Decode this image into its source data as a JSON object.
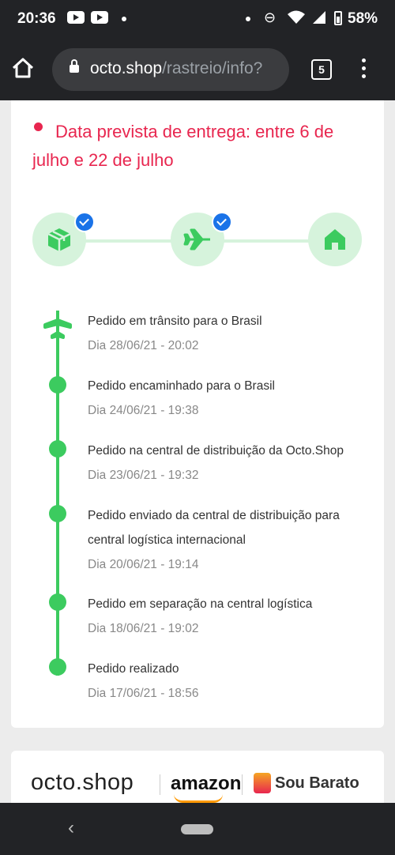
{
  "status_bar": {
    "time": "20:36",
    "battery": "58%"
  },
  "browser": {
    "url_domain": "octo.shop",
    "url_path": "/rastreio/info?",
    "tab_count": "5"
  },
  "delivery": {
    "estimate_text": "Data prevista de entrega: entre 6 de julho e 22 de julho"
  },
  "stepper": {
    "steps": [
      {
        "icon": "package-icon",
        "completed": true
      },
      {
        "icon": "airplane-icon",
        "completed": true
      },
      {
        "icon": "home-icon",
        "completed": false
      }
    ]
  },
  "timeline": {
    "events": [
      {
        "title": "Pedido em trânsito para o Brasil",
        "date": "Dia 28/06/21 - 20:02"
      },
      {
        "title": "Pedido encaminhado para o Brasil",
        "date": "Dia 24/06/21 - 19:38"
      },
      {
        "title": "Pedido na central de distribuição da Octo.Shop",
        "date": "Dia 23/06/21 - 19:32"
      },
      {
        "title": "Pedido enviado da central de distribuição para central logística internacional",
        "date": "Dia 20/06/21 - 19:14"
      },
      {
        "title": "Pedido em separação na central logística",
        "date": "Dia 18/06/21 - 19:02"
      },
      {
        "title": "Pedido realizado",
        "date": "Dia 17/06/21 - 18:56"
      }
    ]
  },
  "brands": {
    "octo": "octo.shop",
    "amazon": "amazon",
    "soubarato": "Sou Barato"
  },
  "colors": {
    "accent_red": "#e8264f",
    "timeline_green": "#3ccb5f",
    "check_blue": "#1a73e8"
  }
}
